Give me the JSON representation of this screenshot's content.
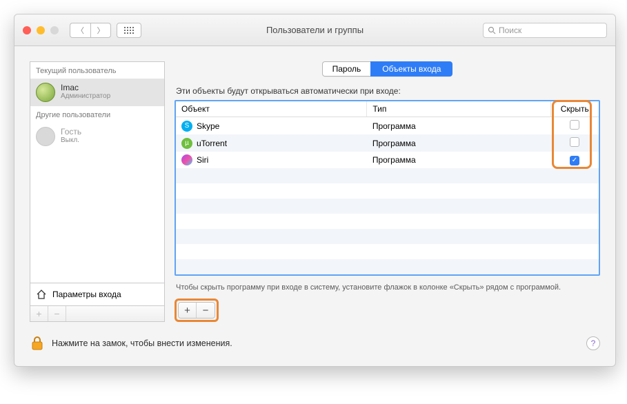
{
  "window": {
    "title": "Пользователи и группы"
  },
  "search": {
    "placeholder": "Поиск"
  },
  "sidebar": {
    "current_label": "Текущий пользователь",
    "user": {
      "name": "Imac",
      "role": "Администратор"
    },
    "others_label": "Другие пользователи",
    "guest": {
      "name": "Гость",
      "status": "Выкл."
    },
    "login_options": "Параметры входа"
  },
  "tabs": {
    "password": "Пароль",
    "login_items": "Объекты входа"
  },
  "main": {
    "heading": "Эти объекты будут открываться автоматически при входе:",
    "columns": {
      "object": "Объект",
      "type": "Тип",
      "hide": "Скрыть"
    },
    "items": [
      {
        "name": "Skype",
        "type": "Программа",
        "hidden": false,
        "icon": "skype"
      },
      {
        "name": "uTorrent",
        "type": "Программа",
        "hidden": false,
        "icon": "utor"
      },
      {
        "name": "Siri",
        "type": "Программа",
        "hidden": true,
        "icon": "siri"
      }
    ],
    "hint": "Чтобы скрыть программу при входе в систему, установите флажок в колонке «Скрыть» рядом с программой."
  },
  "footer": {
    "lock_msg": "Нажмите на замок, чтобы внести изменения."
  }
}
